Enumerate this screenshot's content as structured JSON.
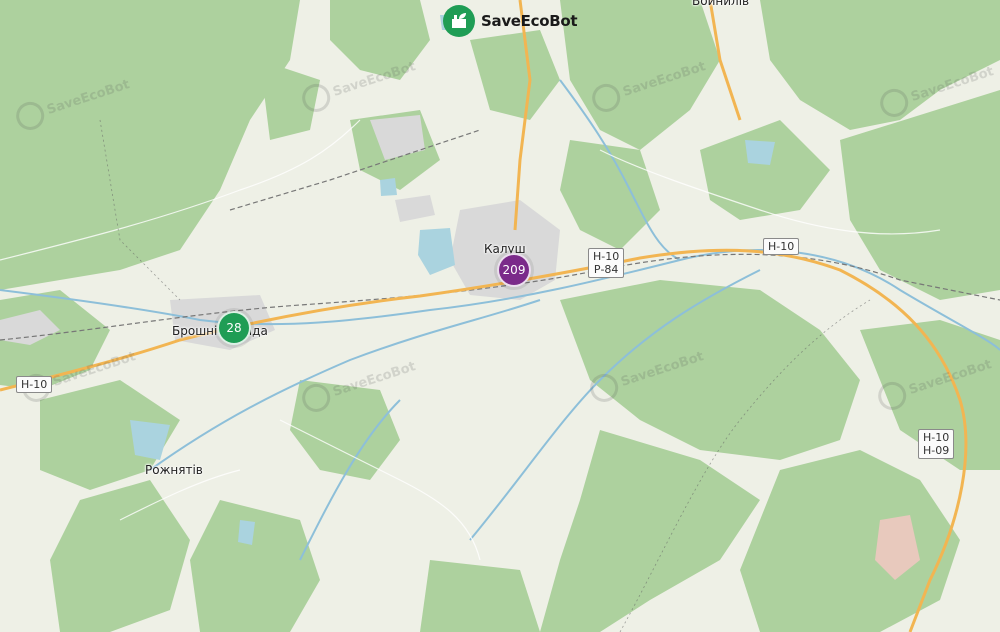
{
  "brand": {
    "name": "SaveEcoBot",
    "accent": "#1f9d55"
  },
  "places": [
    {
      "id": "voinyliv",
      "label": "Войнилів"
    },
    {
      "id": "kalush",
      "label": "Калуш"
    },
    {
      "id": "broshniv",
      "label": "Брошнів-Осада"
    },
    {
      "id": "rozhniativ",
      "label": "Рожнятів"
    }
  ],
  "road_shields": [
    {
      "id": "h10-west",
      "lines": [
        "Н-10"
      ]
    },
    {
      "id": "h10-p84",
      "lines": [
        "Н-10",
        "Р-84"
      ]
    },
    {
      "id": "h10-east",
      "lines": [
        "Н-10"
      ]
    },
    {
      "id": "h10-h09",
      "lines": [
        "Н-10",
        "Н-09"
      ]
    }
  ],
  "markers": [
    {
      "id": "kalush-cluster",
      "count": "209",
      "color": "#7b2a8a"
    },
    {
      "id": "broshniv-cluster",
      "count": "28",
      "color": "#1f9d55"
    }
  ],
  "watermark": {
    "text": "SaveEcoBot"
  },
  "colors": {
    "forest": "#add19e",
    "land": "#eef0e6",
    "urban": "#d9d9d9",
    "water": "#aad3df",
    "road": "#f2b552"
  }
}
